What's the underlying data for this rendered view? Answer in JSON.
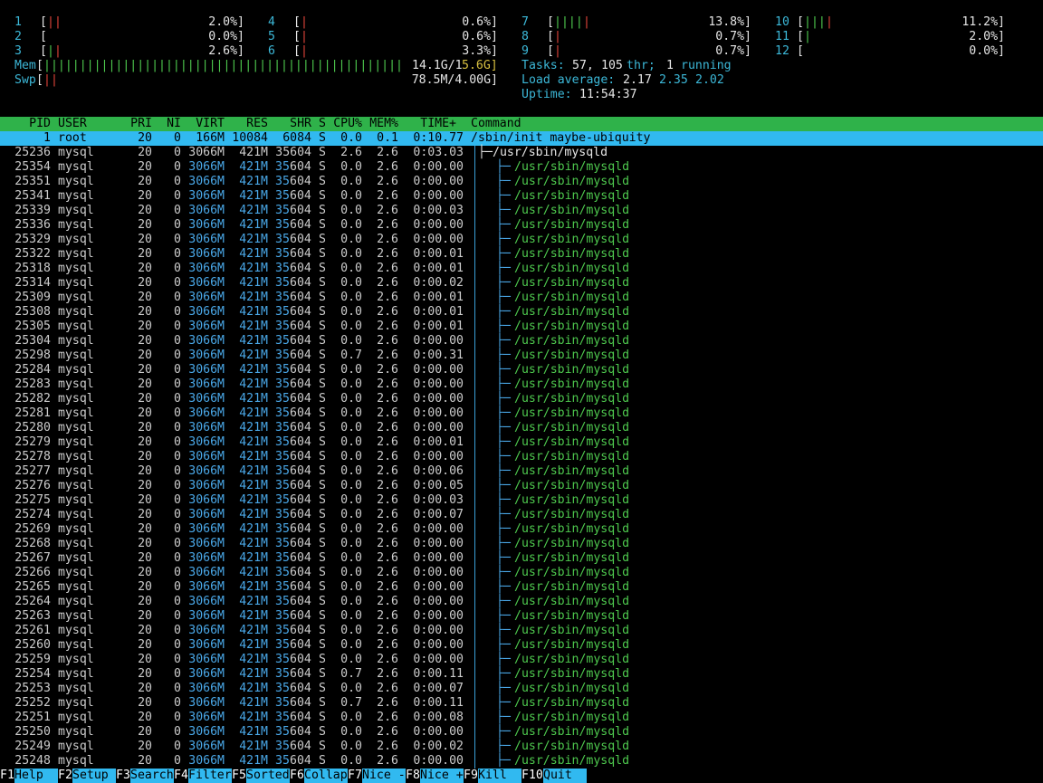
{
  "cpus": [
    {
      "id": "1",
      "pct": "2.0%]",
      "bars": [
        [
          "r",
          "||"
        ]
      ]
    },
    {
      "id": "2",
      "pct": "0.0%]",
      "bars": []
    },
    {
      "id": "3",
      "pct": "2.6%]",
      "bars": [
        [
          "g",
          "|"
        ],
        [
          "r",
          "|"
        ]
      ]
    },
    {
      "id": "4",
      "pct": "0.6%]",
      "bars": [
        [
          "r",
          "|"
        ]
      ]
    },
    {
      "id": "5",
      "pct": "0.6%]",
      "bars": [
        [
          "r",
          "|"
        ]
      ]
    },
    {
      "id": "6",
      "pct": "3.3%]",
      "bars": [
        [
          "r",
          "|"
        ]
      ]
    },
    {
      "id": "7",
      "pct": "13.8%]",
      "bars": [
        [
          "g",
          "||||"
        ],
        [
          "r",
          "|"
        ]
      ]
    },
    {
      "id": "8",
      "pct": "0.7%]",
      "bars": [
        [
          "r",
          "|"
        ]
      ]
    },
    {
      "id": "9",
      "pct": "0.7%]",
      "bars": [
        [
          "r",
          "|"
        ]
      ]
    },
    {
      "id": "10",
      "pct": "11.2%]",
      "bars": [
        [
          "g",
          "|||"
        ],
        [
          "r",
          "|"
        ]
      ]
    },
    {
      "id": "11",
      "pct": "2.0%]",
      "bars": [
        [
          "g",
          "|"
        ]
      ]
    },
    {
      "id": "12",
      "pct": "0.0%]",
      "bars": []
    }
  ],
  "mem": {
    "label": "Mem",
    "value_a": "14.1G/1",
    "value_b": "5.6G]"
  },
  "swp": {
    "label": "Swp",
    "value": "78.5M/4.00G]"
  },
  "tasks": {
    "label": "Tasks:",
    "total": "57,",
    "thr": "105",
    "thr_label": "thr;",
    "running": "1",
    "running_label": "running"
  },
  "load": {
    "label": "Load average:",
    "l1": "2.17",
    "l5": "2.35",
    "l15": "2.02"
  },
  "uptime": {
    "label": "Uptime:",
    "value": "11:54:37"
  },
  "columns": [
    "PID",
    "USER",
    "PRI",
    "NI",
    "VIRT",
    "RES",
    "SHR",
    "S",
    "CPU%",
    "MEM%",
    "TIME+",
    "Command"
  ],
  "first_process": {
    "pid": "1",
    "user": "root",
    "pri": "20",
    "ni": "0",
    "virt": "166M",
    "res": "10084",
    "shr": "6084",
    "s": "S",
    "cpu": "0.0",
    "mem": "0.1",
    "time": "0:10.77",
    "cmd": "/sbin/init maybe-ubiquity"
  },
  "parent_process": {
    "pid": "25236",
    "user": "mysql",
    "pri": "20",
    "ni": "0",
    "virt": "3066M",
    "res": "421M",
    "shr": "35604",
    "s": "S",
    "cpu": "2.6",
    "mem": "2.6",
    "time": "0:03.03",
    "cmd": "/usr/sbin/mysqld"
  },
  "thread_common": {
    "user": "mysql",
    "pri": "20",
    "ni": "0",
    "virt": "3066M",
    "res": "421M",
    "shr_a": "35",
    "shr_b": "604",
    "s": "S",
    "mem": "2.6",
    "cmd": "/usr/sbin/mysqld"
  },
  "threads": [
    [
      "25354",
      "0.0",
      "0:00.00"
    ],
    [
      "25351",
      "0.0",
      "0:00.00"
    ],
    [
      "25341",
      "0.0",
      "0:00.00"
    ],
    [
      "25339",
      "0.0",
      "0:00.03"
    ],
    [
      "25336",
      "0.0",
      "0:00.00"
    ],
    [
      "25329",
      "0.0",
      "0:00.00"
    ],
    [
      "25322",
      "0.0",
      "0:00.01"
    ],
    [
      "25318",
      "0.0",
      "0:00.01"
    ],
    [
      "25314",
      "0.0",
      "0:00.02"
    ],
    [
      "25309",
      "0.0",
      "0:00.01"
    ],
    [
      "25308",
      "0.0",
      "0:00.01"
    ],
    [
      "25305",
      "0.0",
      "0:00.01"
    ],
    [
      "25304",
      "0.0",
      "0:00.00"
    ],
    [
      "25298",
      "0.7",
      "0:00.31"
    ],
    [
      "25284",
      "0.0",
      "0:00.00"
    ],
    [
      "25283",
      "0.0",
      "0:00.00"
    ],
    [
      "25282",
      "0.0",
      "0:00.00"
    ],
    [
      "25281",
      "0.0",
      "0:00.00"
    ],
    [
      "25280",
      "0.0",
      "0:00.00"
    ],
    [
      "25279",
      "0.0",
      "0:00.01"
    ],
    [
      "25278",
      "0.0",
      "0:00.00"
    ],
    [
      "25277",
      "0.0",
      "0:00.06"
    ],
    [
      "25276",
      "0.0",
      "0:00.05"
    ],
    [
      "25275",
      "0.0",
      "0:00.03"
    ],
    [
      "25274",
      "0.0",
      "0:00.07"
    ],
    [
      "25269",
      "0.0",
      "0:00.00"
    ],
    [
      "25268",
      "0.0",
      "0:00.00"
    ],
    [
      "25267",
      "0.0",
      "0:00.00"
    ],
    [
      "25266",
      "0.0",
      "0:00.00"
    ],
    [
      "25265",
      "0.0",
      "0:00.00"
    ],
    [
      "25264",
      "0.0",
      "0:00.00"
    ],
    [
      "25263",
      "0.0",
      "0:00.00"
    ],
    [
      "25261",
      "0.0",
      "0:00.00"
    ],
    [
      "25260",
      "0.0",
      "0:00.00"
    ],
    [
      "25259",
      "0.0",
      "0:00.00"
    ],
    [
      "25254",
      "0.7",
      "0:00.11"
    ],
    [
      "25253",
      "0.0",
      "0:00.07"
    ],
    [
      "25252",
      "0.7",
      "0:00.11"
    ],
    [
      "25251",
      "0.0",
      "0:00.08"
    ],
    [
      "25250",
      "0.0",
      "0:00.00"
    ],
    [
      "25249",
      "0.0",
      "0:00.02"
    ],
    [
      "25248",
      "0.0",
      "0:00.00"
    ]
  ],
  "tree_glyph": "├─",
  "tree_glyph_top": "├─",
  "footer": [
    {
      "key": "F1",
      "label": "Help  "
    },
    {
      "key": "F2",
      "label": "Setup "
    },
    {
      "key": "F3",
      "label": "Search"
    },
    {
      "key": "F4",
      "label": "Filter"
    },
    {
      "key": "F5",
      "label": "Sorted"
    },
    {
      "key": "F6",
      "label": "Collap"
    },
    {
      "key": "F7",
      "label": "Nice -"
    },
    {
      "key": "F8",
      "label": "Nice +"
    },
    {
      "key": "F9",
      "label": "Kill  "
    },
    {
      "key": "F10",
      "label": "Quit  "
    }
  ],
  "colors": {
    "header_bg": "#2fb24a",
    "selected_bg": "#31b9f0",
    "tree": "#4ec94e",
    "accent": "#4aa8e8"
  }
}
